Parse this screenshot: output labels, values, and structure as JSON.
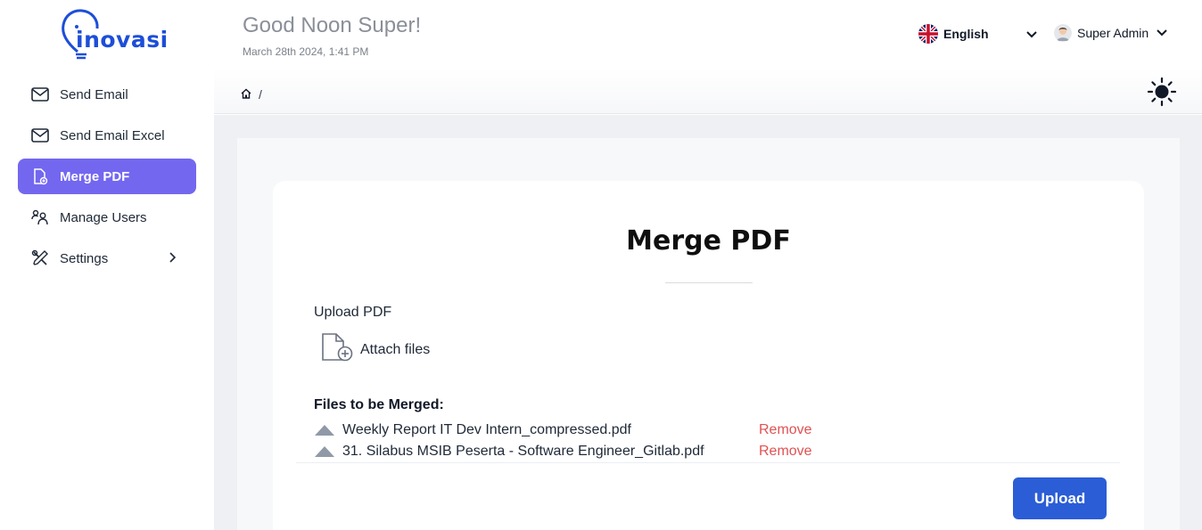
{
  "app": {
    "logo_text": "inovasi"
  },
  "sidebar": {
    "items": [
      {
        "label": "Send Email",
        "icon": "mail-icon"
      },
      {
        "label": "Send Email Excel",
        "icon": "mail-icon"
      },
      {
        "label": "Merge PDF",
        "icon": "file-merge-icon",
        "active": true
      },
      {
        "label": "Manage Users",
        "icon": "users-icon"
      },
      {
        "label": "Settings",
        "icon": "tools-icon",
        "has_submenu": true
      }
    ]
  },
  "header": {
    "greeting": "Good Noon Super!",
    "datetime": "March 28th 2024, 1:41 PM",
    "language": "English",
    "user_name": "Super Admin"
  },
  "breadcrumb": {
    "separator": "/"
  },
  "main": {
    "title": "Merge PDF",
    "upload_label": "Upload PDF",
    "attach_label": "Attach files",
    "files_heading": "Files to be Merged:",
    "files": [
      {
        "name": "Weekly Report IT Dev Intern_compressed.pdf",
        "action": "Remove"
      },
      {
        "name": "31. Silabus MSIB Peserta - Software Engineer_Gitlab.pdf",
        "action": "Remove"
      }
    ],
    "upload_button": "Upload"
  },
  "colors": {
    "accent": "#7367f0",
    "primary_button": "#2b5dd6",
    "remove_text": "#e05252",
    "logo": "#1d4ed8"
  }
}
